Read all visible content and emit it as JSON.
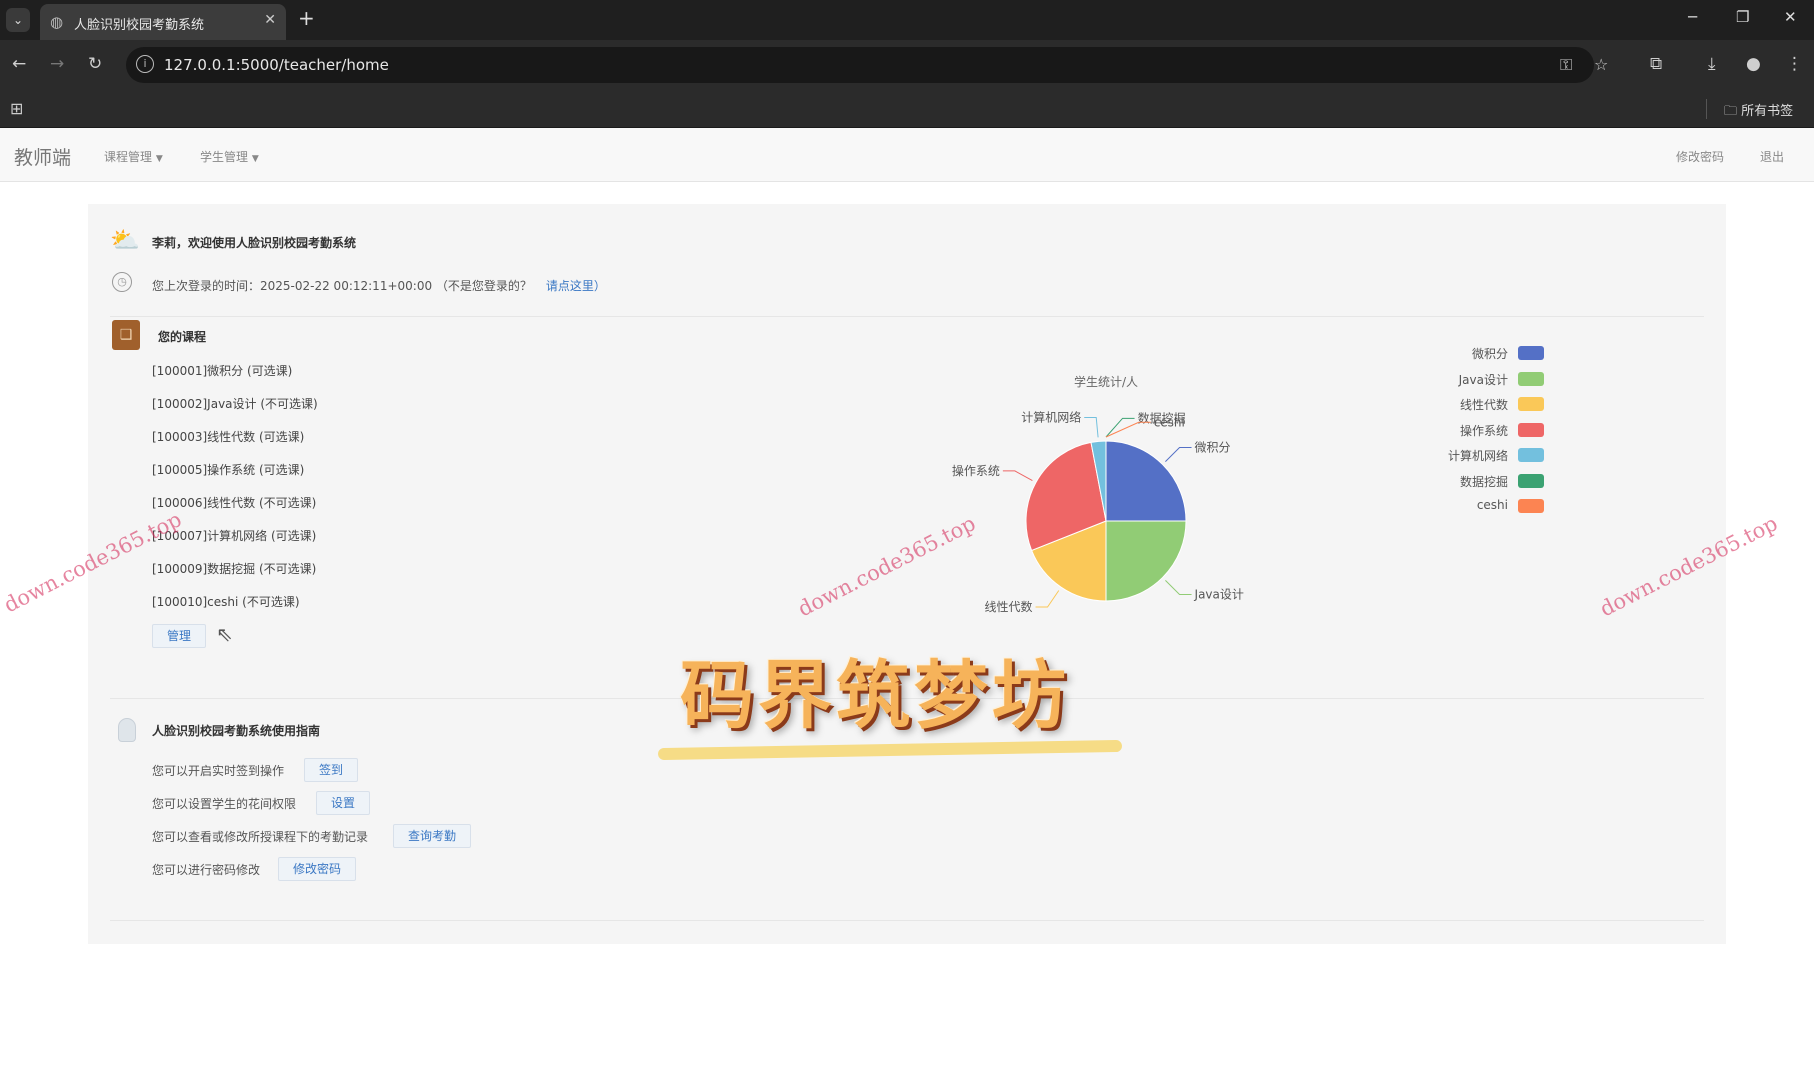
{
  "browser": {
    "tab_title": "人脸识别校园考勤系统",
    "url": "127.0.0.1:5000/teacher/home",
    "bookmarks_all": "所有书签"
  },
  "navbar": {
    "brand": "教师端",
    "menu": [
      "课程管理",
      "学生管理"
    ],
    "right": [
      "修改密码",
      "退出"
    ]
  },
  "welcome": {
    "greeting": "李莉，欢迎使用人脸识别校园考勤系统",
    "last_login": "您上次登录的时间：2025-02-22 00:12:11+00:00 （不是您登录的？",
    "last_login_link": "请点这里）"
  },
  "courses": {
    "heading": "您的课程",
    "items": [
      "[100001]微积分 (可选课)",
      "[100002]Java设计 (不可选课)",
      "[100003]线性代数 (可选课)",
      "[100005]操作系统 (可选课)",
      "[100006]线性代数 (不可选课)",
      "[100007]计算机网络 (可选课)",
      "[100009]数据挖掘 (不可选课)",
      "[100010]ceshi (不可选课)"
    ],
    "manage_button": "管理"
  },
  "guide": {
    "heading": "人脸识别校园考勤系统使用指南",
    "rows": [
      {
        "text": "您可以开启实时签到操作",
        "button": "签到"
      },
      {
        "text": "您可以设置学生的花间权限",
        "button": "设置"
      },
      {
        "text": "您可以查看或修改所授课程下的考勤记录",
        "button": "查询考勤"
      },
      {
        "text": "您可以进行密码修改",
        "button": "修改密码"
      }
    ]
  },
  "chart_data": {
    "type": "pie",
    "title": "学生统计/人",
    "categories": [
      "微积分",
      "Java设计",
      "线性代数",
      "操作系统",
      "计算机网络",
      "数据挖掘",
      "ceshi"
    ],
    "values": [
      25,
      25,
      19,
      28,
      3,
      0,
      0
    ],
    "colors": [
      "#5470c6",
      "#91cc75",
      "#fac858",
      "#ee6666",
      "#73c0de",
      "#3ba272",
      "#fc8452"
    ],
    "legend_position": "right"
  },
  "overlay": {
    "watermark": "down.code365.top",
    "title": "码界筑梦坊"
  }
}
